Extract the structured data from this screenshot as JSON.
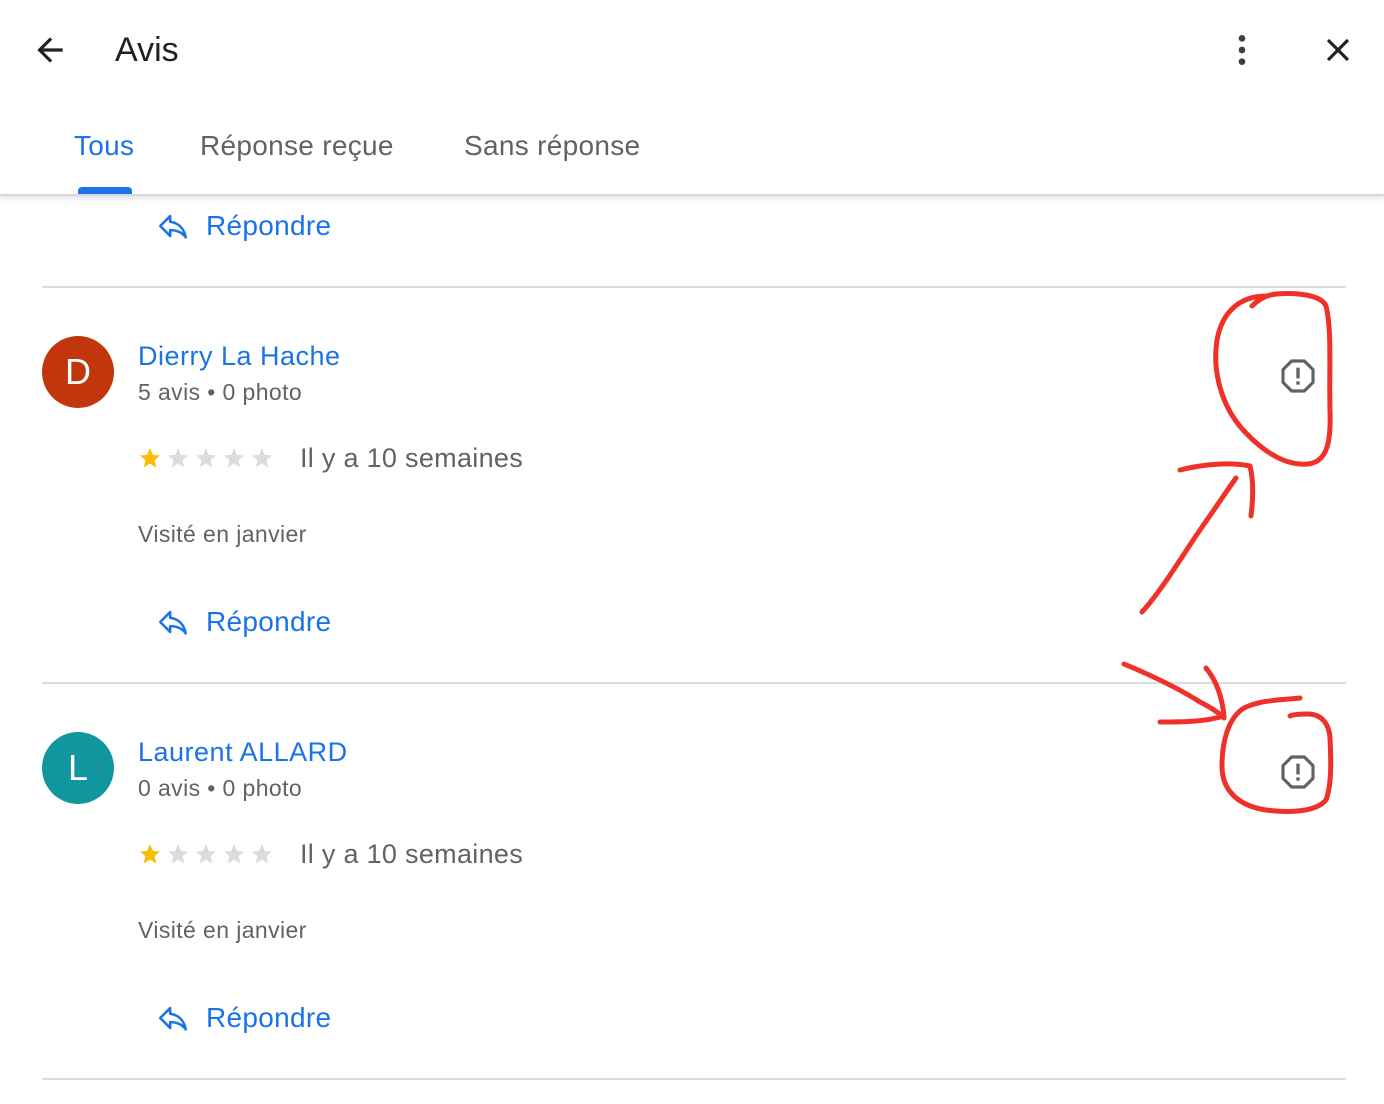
{
  "header": {
    "title": "Avis",
    "back_icon": "arrow-back-icon",
    "more_icon": "more-vert-icon",
    "close_icon": "close-icon"
  },
  "tabs": [
    {
      "label": "Tous",
      "active": true
    },
    {
      "label": "Réponse reçue",
      "active": false
    },
    {
      "label": "Sans réponse",
      "active": false
    }
  ],
  "reply_label": "Répondre",
  "reviews": [
    {
      "initial": "D",
      "avatar_color": "#c1360d",
      "name": "Dierry La Hache",
      "meta": "5 avis • 0 photo",
      "rating": 1,
      "time": "Il y a 10 semaines",
      "visited": "Visité en janvier"
    },
    {
      "initial": "L",
      "avatar_color": "#11959f",
      "name": "Laurent ALLARD",
      "meta": "0 avis • 0 photo",
      "rating": 1,
      "time": "Il y a 10 semaines",
      "visited": "Visité en janvier"
    }
  ],
  "colors": {
    "accent": "#1a73e8",
    "star_filled": "#fbbc04",
    "star_empty": "#dadce0",
    "annotation": "#f0312a"
  }
}
